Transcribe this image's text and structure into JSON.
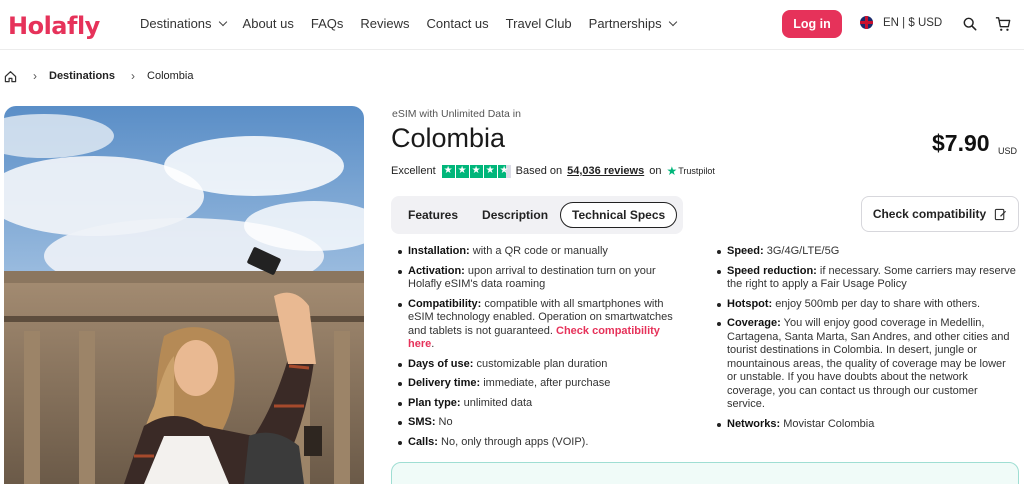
{
  "brand": {
    "logo_text": "Holafly",
    "accent_color": "#e6325a"
  },
  "nav": {
    "items": [
      {
        "label": "Destinations",
        "has_dropdown": true
      },
      {
        "label": "About us",
        "has_dropdown": false
      },
      {
        "label": "FAQs",
        "has_dropdown": false
      },
      {
        "label": "Reviews",
        "has_dropdown": false
      },
      {
        "label": "Contact us",
        "has_dropdown": false
      },
      {
        "label": "Travel Club",
        "has_dropdown": false
      },
      {
        "label": "Partnerships",
        "has_dropdown": true
      }
    ],
    "login_label": "Log in",
    "lang_label": "EN | $ USD"
  },
  "breadcrumb": {
    "destinations": "Destinations",
    "current": "Colombia"
  },
  "product": {
    "subtitle": "eSIM with Unlimited Data in",
    "title": "Colombia",
    "price": "$7.90",
    "currency": "USD",
    "rating_word": "Excellent",
    "stars": 4.5,
    "based_on": "Based on",
    "review_count": "54,036 reviews",
    "on": "on",
    "trustpilot": "Trustpilot"
  },
  "tabs": {
    "features": "Features",
    "description": "Description",
    "tech_specs": "Technical Specs",
    "active": "Technical Specs"
  },
  "check_compat_label": "Check compatibility",
  "specs_left": {
    "installation": {
      "label": "Installation:",
      "text": " with a QR code or manually"
    },
    "activation": {
      "label": "Activation:",
      "text": " upon arrival to destination turn on your Holafly eSIM's data roaming"
    },
    "compatibility": {
      "label": "Compatibility:",
      "text": " compatible with all smartphones with eSIM technology enabled. Operation on smartwatches and tablets is not guaranteed. ",
      "link": "Check compatibility here",
      "tail": "."
    },
    "days": {
      "label": "Days of use:",
      "text": " customizable plan duration"
    },
    "delivery": {
      "label": "Delivery time:",
      "text": " immediate, after purchase"
    },
    "plan": {
      "label": "Plan type:",
      "text": " unlimited data"
    },
    "sms": {
      "label": "SMS:",
      "text": " No"
    },
    "calls": {
      "label": "Calls:",
      "text": " No, only through apps (VOIP)."
    }
  },
  "specs_right": {
    "speed": {
      "label": "Speed:",
      "text": " 3G/4G/LTE/5G"
    },
    "speed_reduction": {
      "label": "Speed reduction:",
      "text": " if necessary. Some carriers may reserve the right to apply a Fair Usage Policy"
    },
    "hotspot": {
      "label": "Hotspot:",
      "text": " enjoy 500mb per day to share with others."
    },
    "coverage": {
      "label": "Coverage:",
      "text": " You will enjoy good coverage in Medellin, Cartagena, Santa Marta, San Andres, and other cities and tourist destinations in Colombia. In desert, jungle or mountainous areas, the quality of coverage may be lower or unstable. If you have doubts about the network coverage, you can contact us through our customer service."
    },
    "networks": {
      "label": "Networks:",
      "text": " Movistar Colombia"
    }
  }
}
